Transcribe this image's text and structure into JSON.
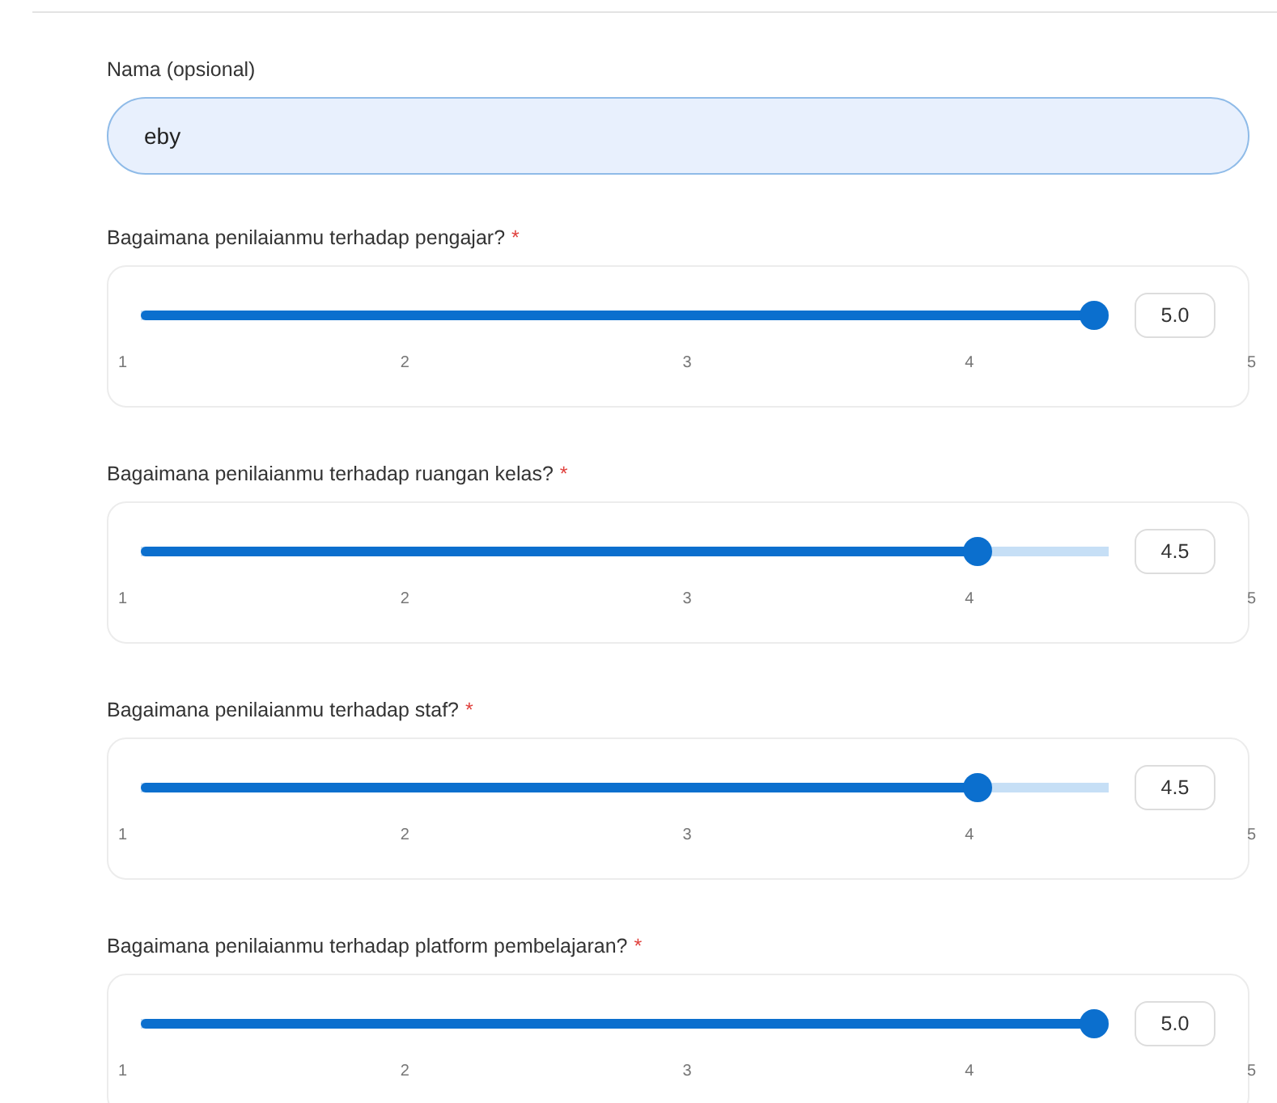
{
  "name_field": {
    "label": "Nama (opsional)",
    "value": "eby"
  },
  "questions": [
    {
      "label": "Bagaimana penilaianmu terhadap pengajar?",
      "required_mark": "*",
      "level": 1,
      "reading": "5.0",
      "ticks": [
        "1",
        "2",
        "3",
        "4",
        "5"
      ]
    },
    {
      "label": "Bagaimana penilaianmu terhadap ruangan kelas?",
      "required_mark": "*",
      "level": 0.875,
      "reading": "4.5",
      "ticks": [
        "1",
        "2",
        "3",
        "4",
        "5"
      ]
    },
    {
      "label": "Bagaimana penilaianmu terhadap staf?",
      "required_mark": "*",
      "level": 0.875,
      "reading": "4.5",
      "ticks": [
        "1",
        "2",
        "3",
        "4",
        "5"
      ]
    },
    {
      "label": "Bagaimana penilaianmu terhadap platform pembelajaran?",
      "required_mark": "*",
      "level": 1,
      "reading": "5.0",
      "ticks": [
        "1",
        "2",
        "3",
        "4",
        "5"
      ]
    }
  ]
}
